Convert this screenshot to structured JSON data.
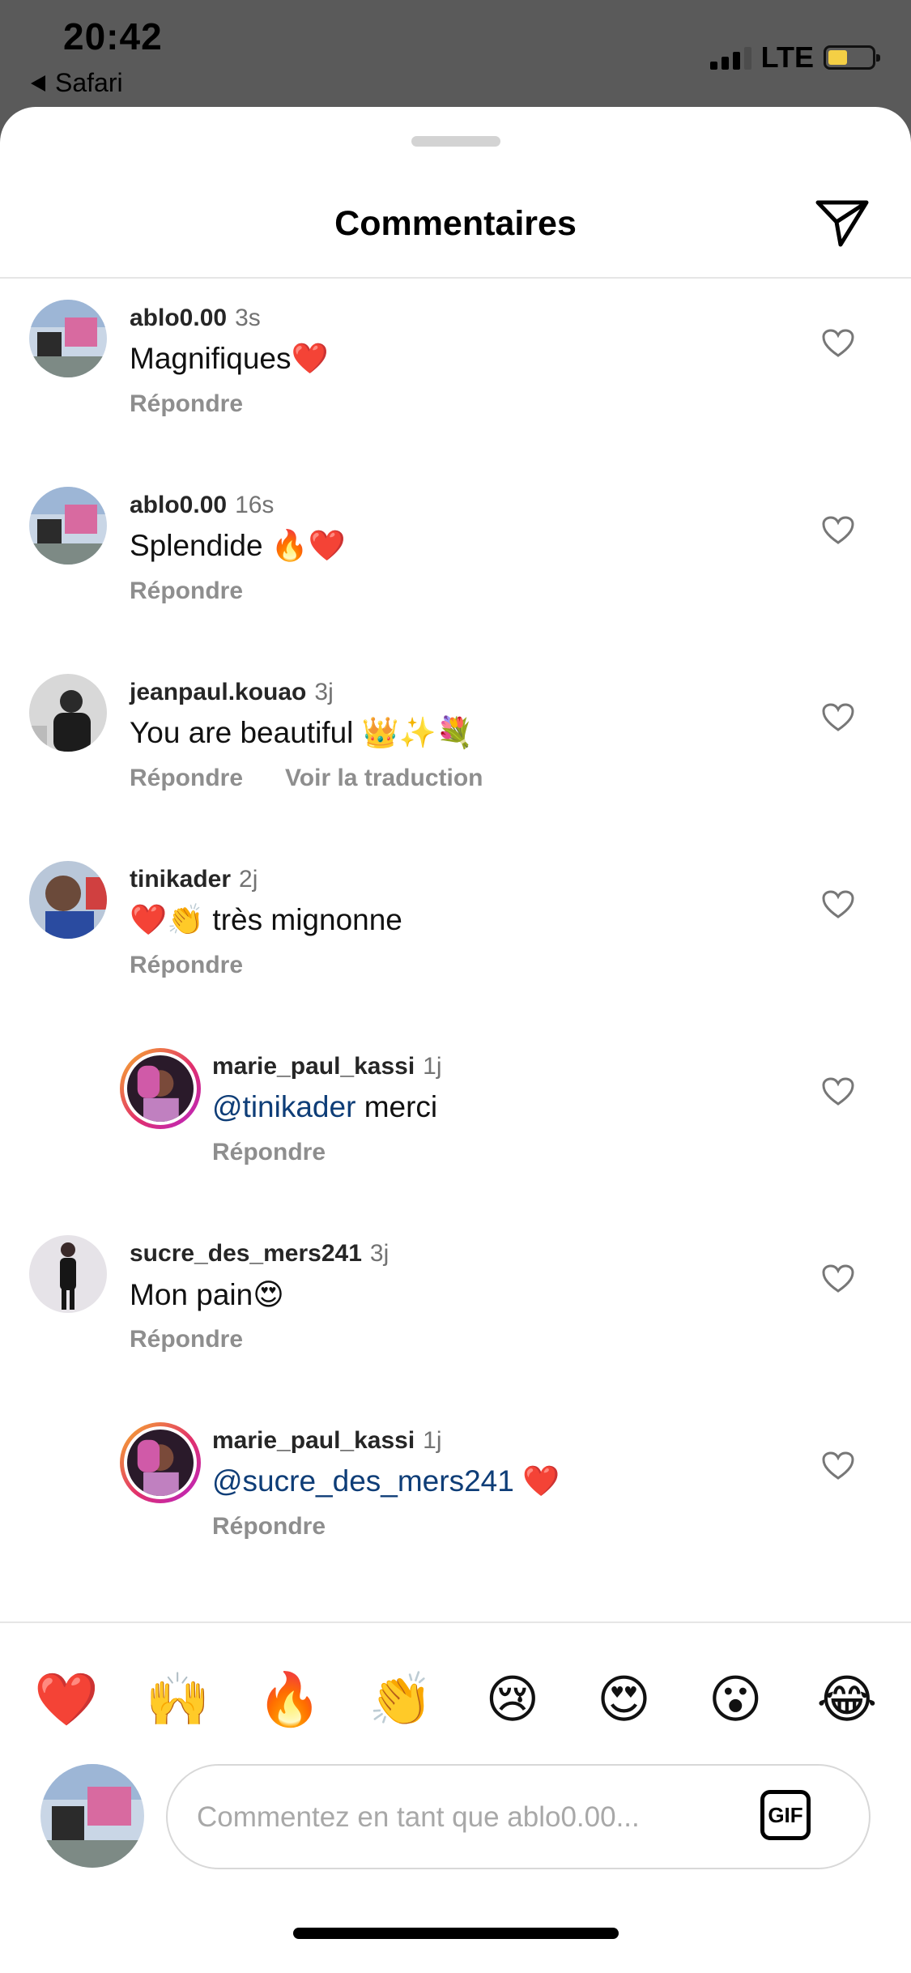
{
  "status_bar": {
    "time": "20:42",
    "back_label": "Safari",
    "network": "LTE",
    "signal_bars_active": 3,
    "battery_level": 0.35,
    "battery_color": "#f4cf45"
  },
  "sheet": {
    "title": "Commentaires",
    "share_icon": "send-icon"
  },
  "comments": [
    {
      "username": "ablo0.00",
      "time": "3s",
      "text": "Magnifiques❤️",
      "reply": "Répondre"
    },
    {
      "username": "ablo0.00",
      "time": "16s",
      "text": "Splendide 🔥❤️",
      "reply": "Répondre"
    },
    {
      "username": "jeanpaul.kouao",
      "time": "3j",
      "text": "You are beautiful 👑✨💐",
      "reply": "Répondre",
      "translate": "Voir la traduction"
    },
    {
      "username": "tinikader",
      "time": "2j",
      "text": "❤️👏 très mignonne",
      "reply": "Répondre"
    },
    {
      "username": "marie_paul_kassi",
      "time": "1j",
      "mention": "@tinikader",
      "text": " merci",
      "reply": "Répondre"
    },
    {
      "username": "sucre_des_mers241",
      "time": "3j",
      "text": "Mon pain😍",
      "reply": "Répondre"
    },
    {
      "username": "marie_paul_kassi",
      "time": "1j",
      "mention": "@sucre_des_mers241",
      "text": " ❤️",
      "reply": "Répondre"
    }
  ],
  "reactions": [
    "❤️",
    "🙌",
    "🔥",
    "👏",
    "😢",
    "😍",
    "😮",
    "😂"
  ],
  "composer": {
    "placeholder": "Commentez en tant que ablo0.00...",
    "gif_label": "GIF"
  },
  "colors": {
    "mention": "#0e3d77",
    "secondary_text": "#8e8e8e"
  }
}
